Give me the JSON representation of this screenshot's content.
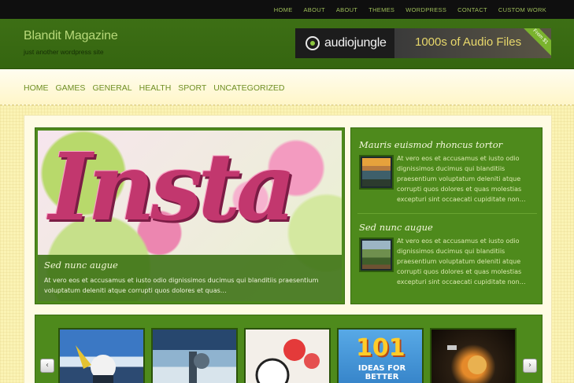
{
  "topnav": [
    "HOME",
    "ABOUT",
    "ABOUT",
    "THEMES",
    "WORDPRESS",
    "CONTACT",
    "CUSTOM WORK"
  ],
  "site": {
    "title": "Blandit Magazine",
    "tagline": "just another wordpress site"
  },
  "banner": {
    "brand": "audiojungle",
    "offer": "1000s of Audio Files",
    "ribbon": "From $1"
  },
  "mainnav": [
    "HOME",
    "GAMES",
    "GENERAL",
    "HEALTH",
    "SPORT",
    "UNCATEGORIZED"
  ],
  "featured": {
    "image_word": "Insta",
    "title": "Sed nunc augue",
    "excerpt": "At vero eos et accusamus et iusto odio dignissimos ducimus qui blanditiis praesentium voluptatum deleniti atque corrupti quos dolores et quas…"
  },
  "sideposts": [
    {
      "title": "Mauris euismod rhoncus tortor",
      "excerpt": "At vero eos et accusamus et iusto odio dignissimos ducimus qui blanditiis praesentium voluptatum deleniti atque corrupti quos dolores et quas molestias excepturi sint occaecati cupiditate non…"
    },
    {
      "title": "Sed nunc augue",
      "excerpt": "At vero eos et accusamus et iusto odio dignissimos ducimus qui blanditiis praesentium voluptatum deleniti atque corrupti quos dolores et quas molestias excepturi sint occaecati cupiditate non…"
    }
  ],
  "carousel": {
    "prev_icon": "chevron-left-icon",
    "next_icon": "chevron-right-icon",
    "thumb4_text_top": "101",
    "thumb4_text_bottom": "IDEAS FOR BETTER"
  },
  "colors": {
    "accent_green": "#4e8a1c",
    "header_green": "#3d6f15",
    "link_green": "#6f8f25",
    "page_yellow": "#fbf3b4"
  }
}
